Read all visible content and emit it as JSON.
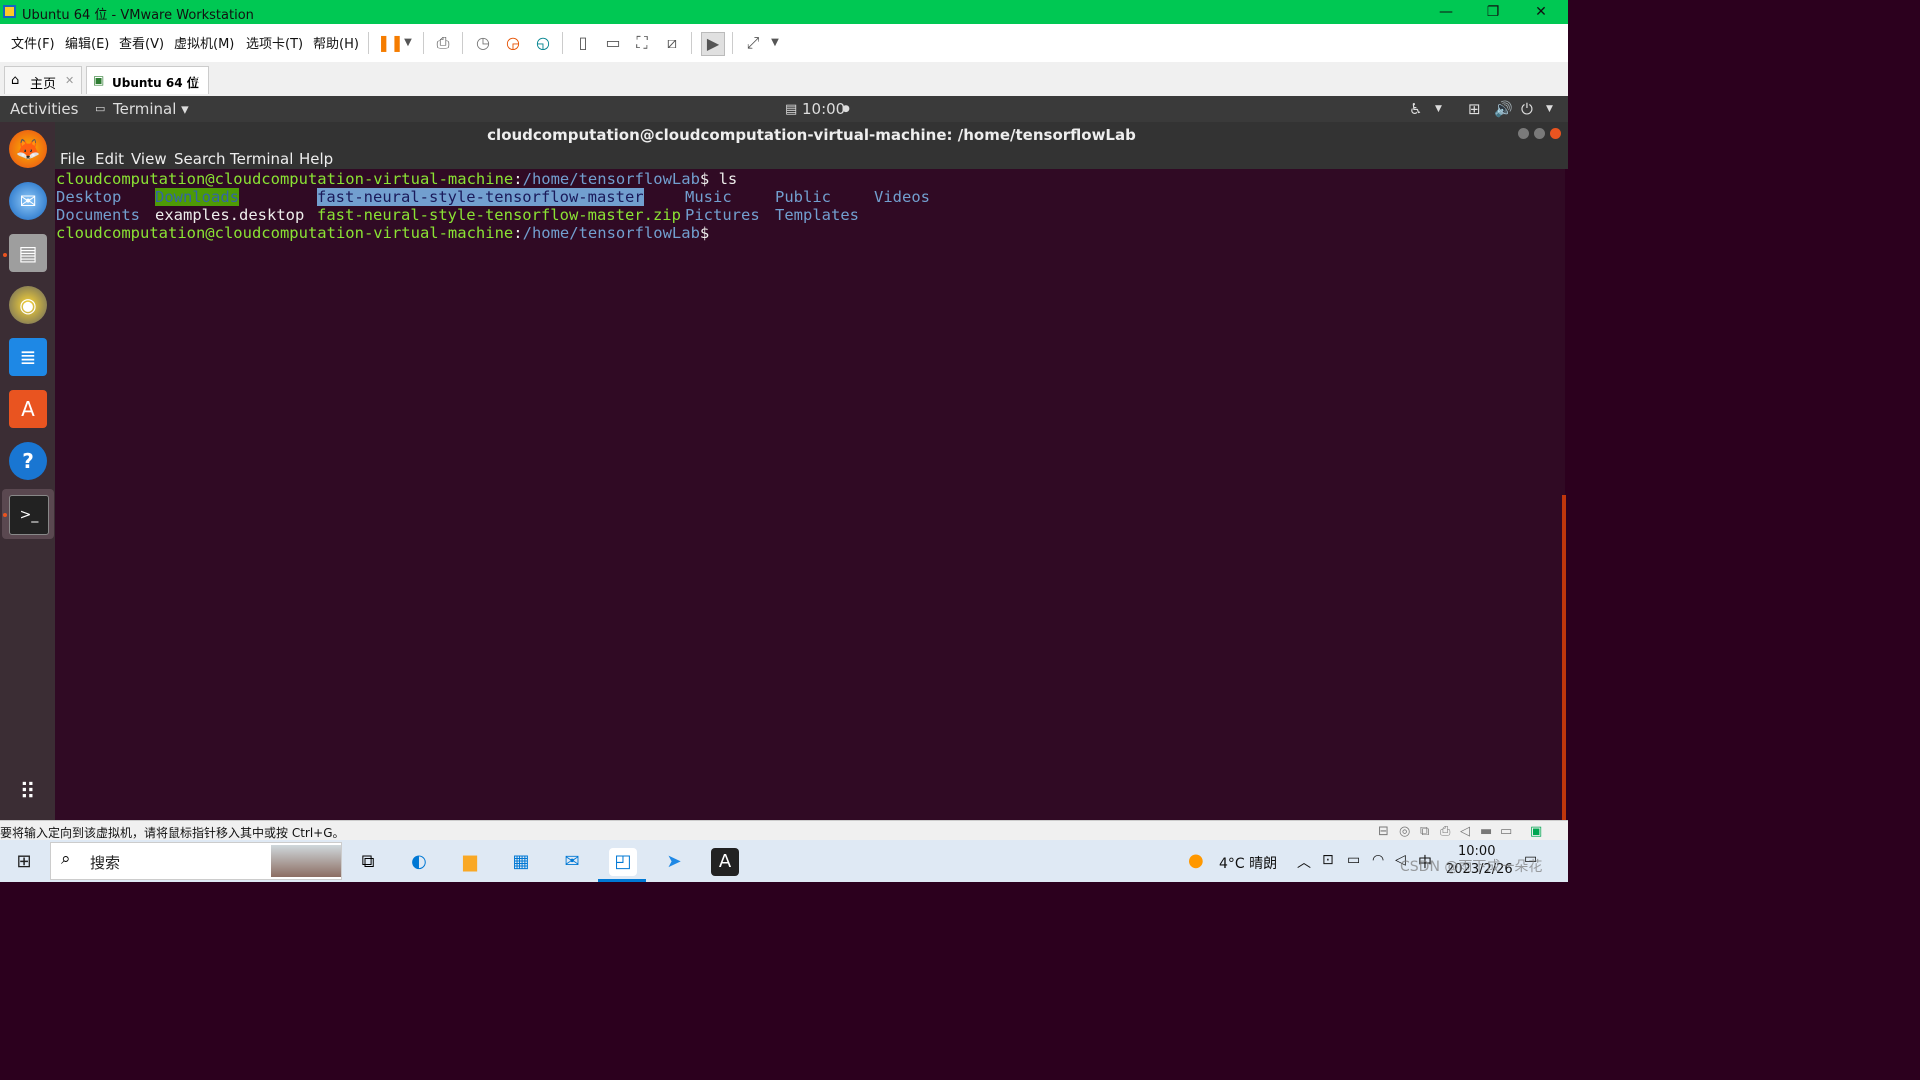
{
  "host": {
    "title": "Ubuntu 64 位 - VMware Workstation",
    "window_buttons": [
      "—",
      "❐",
      "✕"
    ],
    "menu": [
      "文件(F)",
      "编辑(E)",
      "查看(V)",
      "虚拟机(M)",
      "选项卡(T)",
      "帮助(H)"
    ],
    "tabs": [
      {
        "label": "主页",
        "close": "✕"
      },
      {
        "label": "Ubuntu 64 位",
        "close": "✕"
      }
    ],
    "status_message": "要将输入定向到该虚拟机，请将鼠标指针移入其中或按 Ctrl+G。"
  },
  "ubuntu": {
    "activities": "Activities",
    "app_menu": "Terminal ▾",
    "clock": "10:00",
    "tray_icons": [
      "accessibility-icon",
      "network-icon",
      "volume-icon",
      "power-icon"
    ]
  },
  "terminal": {
    "title": "cloudcomputation@cloudcomputation-virtual-machine: /home/tensorflowLab",
    "menu": [
      "File",
      "Edit",
      "View",
      "Search",
      "Terminal",
      "Help"
    ],
    "prompt_user": "cloudcomputation@cloudcomputation-virtual-machine",
    "prompt_colon": ":",
    "prompt_path": "/home/tensorflowLab",
    "prompt_dollar": "$",
    "command": " ls",
    "listing": {
      "col1": [
        "Desktop",
        "Documents"
      ],
      "col2": [
        "Downloads",
        "examples.desktop"
      ],
      "col3": [
        "fast-neural-style-tensorflow-master",
        "fast-neural-style-tensorflow-master.zip"
      ],
      "col4": [
        "Music",
        "Pictures"
      ],
      "col5": [
        "Public",
        "Templates"
      ],
      "col6": [
        "Videos"
      ]
    }
  },
  "taskbar": {
    "search_placeholder": "搜索",
    "weather": "4°C 晴朗",
    "ime": "中",
    "time": "10:00",
    "date": "2023/2/26",
    "watermark": "CSDN @雨下成一朵花"
  }
}
